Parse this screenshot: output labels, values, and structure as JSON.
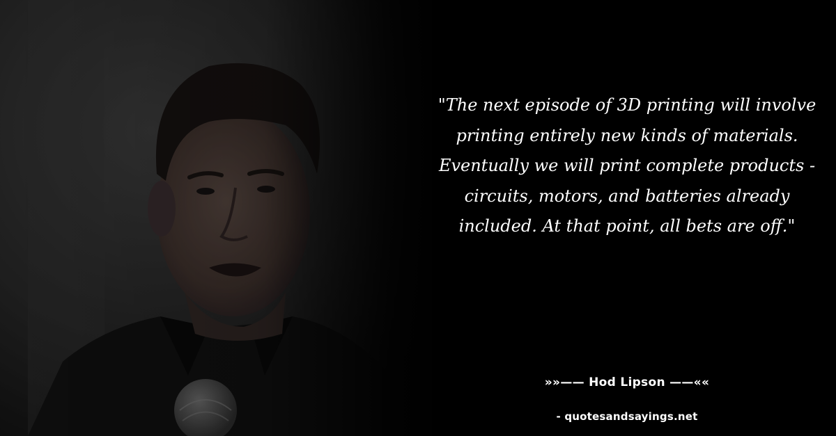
{
  "photo": {
    "subject": "speaker-portrait"
  },
  "quote": {
    "text": "\"The next episode of 3D printing will involve printing entirely new kinds of materials. Eventually we will print complete products - circuits, motors, and batteries already included. At that point, all bets are off.\""
  },
  "author": {
    "text": "»»—— Hod Lipson ——««"
  },
  "source": {
    "text": "- quotesandsayings.net"
  },
  "colors": {
    "background": "#000000",
    "text": "#ffffff"
  }
}
